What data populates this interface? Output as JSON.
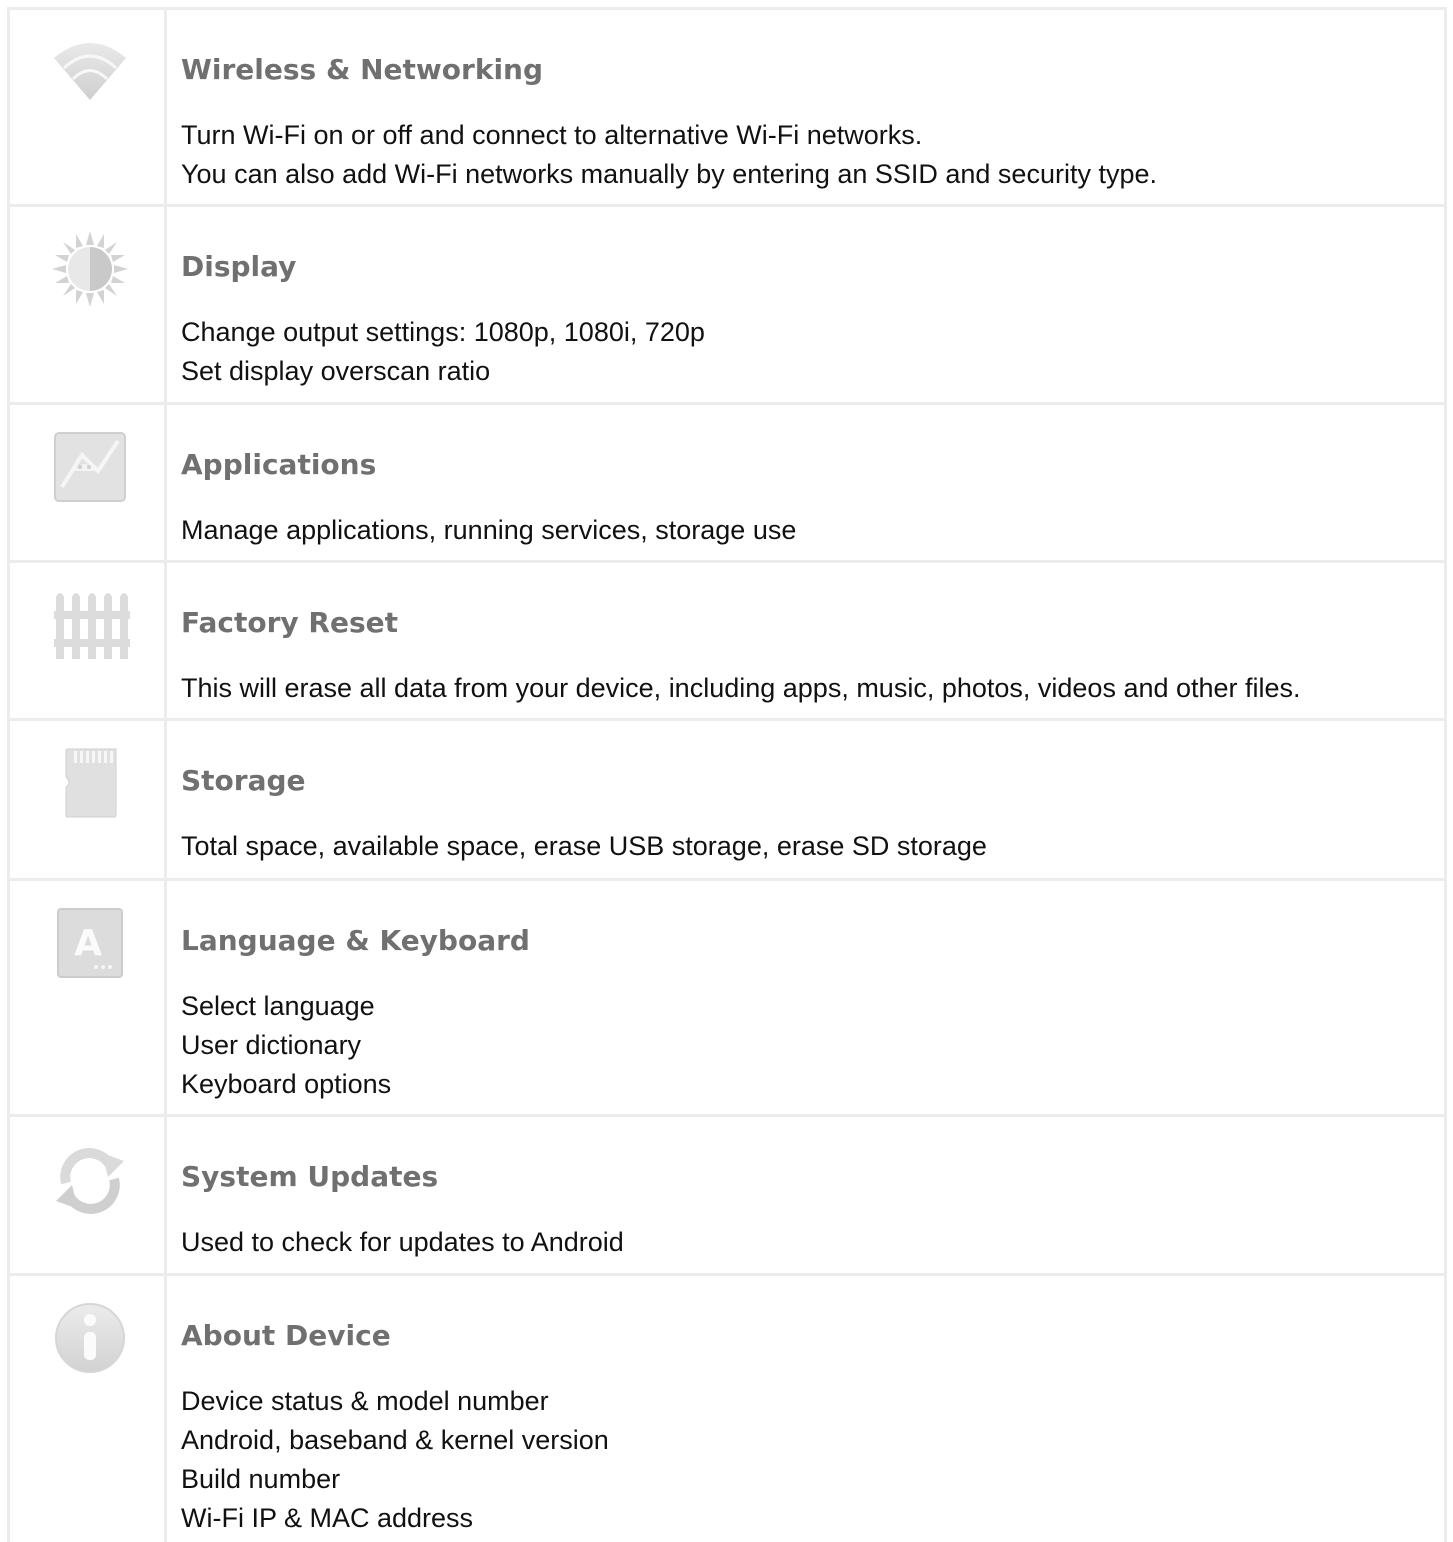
{
  "settings": {
    "items": [
      {
        "icon": "wifi-icon",
        "title": "Wireless & Networking",
        "lines": [
          "Turn Wi-Fi on or off and connect to alternative Wi-Fi networks.",
          "You can also add Wi-Fi networks manually by entering an SSID and security type."
        ]
      },
      {
        "icon": "brightness-icon",
        "title": "Display",
        "lines": [
          "Change output settings: 1080p, 1080i, 720p",
          "Set display overscan ratio"
        ]
      },
      {
        "icon": "applications-icon",
        "title": "Applications",
        "lines": [
          "Manage applications, running services, storage use"
        ]
      },
      {
        "icon": "fence-icon",
        "title": "Factory Reset",
        "lines": [
          "This will erase all data from your device, including apps, music, photos, videos and other files."
        ]
      },
      {
        "icon": "sd-card-icon",
        "title": "Storage",
        "lines": [
          "Total space, available space, erase USB storage, erase SD storage"
        ]
      },
      {
        "icon": "language-icon",
        "title": "Language & Keyboard",
        "lines": [
          "Select language",
          "User dictionary",
          "Keyboard options"
        ]
      },
      {
        "icon": "sync-icon",
        "title": "System Updates",
        "lines": [
          "Used to check for updates to Android"
        ]
      },
      {
        "icon": "info-icon",
        "title": "About Device",
        "lines": [
          "Device status & model number",
          "Android, baseband & kernel version",
          "Build number",
          "Wi-Fi IP & MAC address"
        ]
      }
    ]
  }
}
